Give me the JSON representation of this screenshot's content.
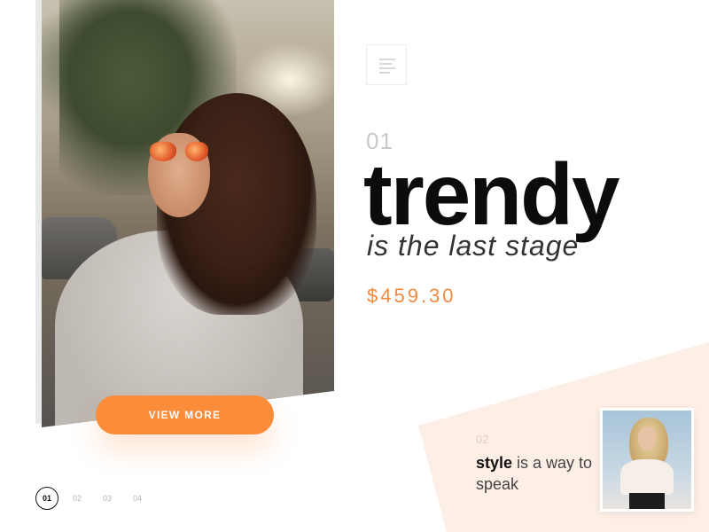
{
  "hero": {
    "image": "woman-with-orange-sunglasses-photo",
    "button_label": "VIEW MORE"
  },
  "menu": {
    "icon": "menu-bars-icon"
  },
  "feature": {
    "number": "01",
    "title": "trendy",
    "subtitle": "is the last stage",
    "price": "$459.30"
  },
  "next_item": {
    "number": "02",
    "bold": "style",
    "rest": " is a way to speak",
    "image": "blonde-woman-photo"
  },
  "pager": {
    "pages": [
      "01",
      "02",
      "03",
      "04"
    ],
    "active": "01"
  },
  "colors": {
    "accent": "#fb8c3a",
    "price": "#f48a3e",
    "panel": "#fdeee6"
  }
}
